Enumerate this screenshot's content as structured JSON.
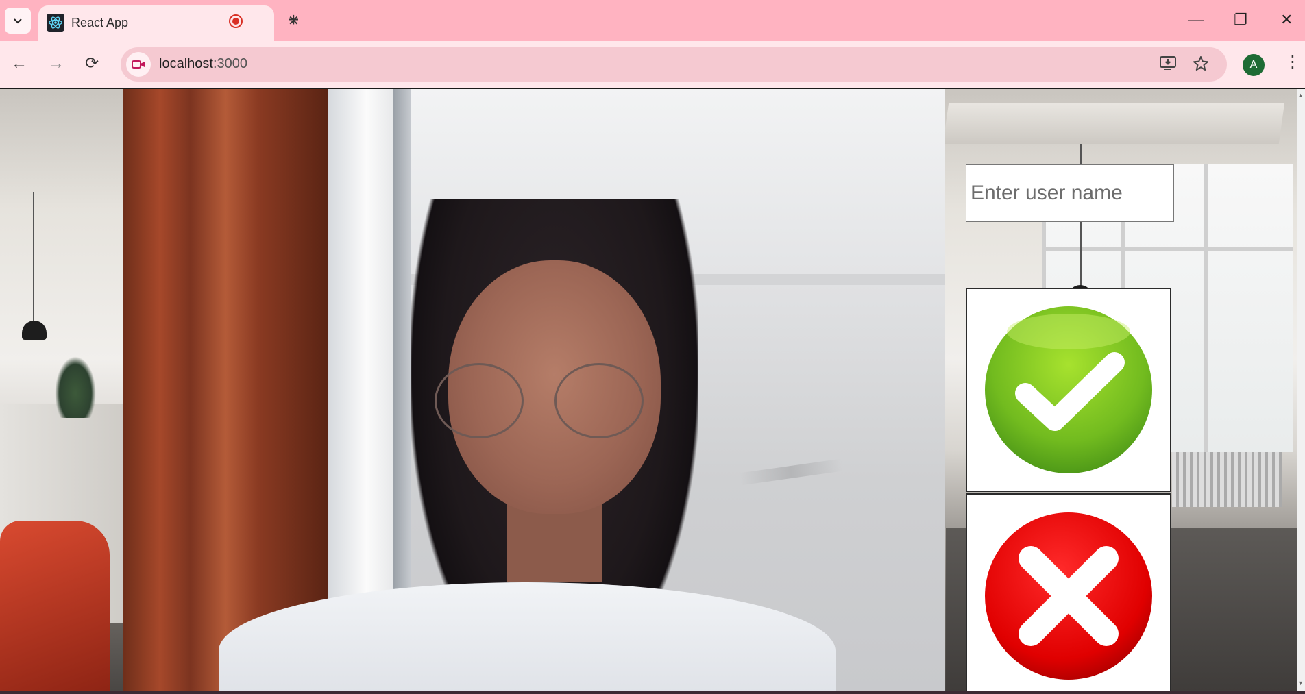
{
  "browser": {
    "tab": {
      "title": "React App",
      "favicon": "react-icon",
      "recording_indicator": "recording-icon",
      "close_symbol": "✕"
    },
    "new_tab_symbol": "+",
    "window_controls": {
      "minimize": "—",
      "restore": "❐",
      "close": "✕"
    },
    "nav": {
      "back": "←",
      "forward": "→",
      "reload": "⟳"
    },
    "address": {
      "host": "localhost",
      "port": ":3000"
    },
    "profile_initial": "A",
    "menu_symbol": "⋮",
    "accent_color": "#ffb3c1"
  },
  "page": {
    "username_field": {
      "placeholder": "Enter user name",
      "value": ""
    },
    "accept_button": {
      "icon": "check-icon",
      "color": "#7cc21f"
    },
    "reject_button": {
      "icon": "x-icon",
      "color": "#e00000"
    }
  }
}
